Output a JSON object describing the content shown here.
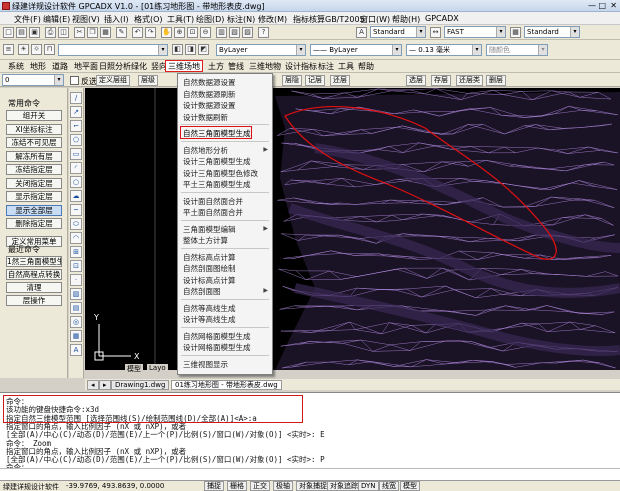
{
  "window": {
    "title": "绿建详规设计软件 GPCADX V1.0 - [01练习地形图 - 带地形表皮.dwg]",
    "minimize": "—",
    "maximize": "□",
    "close": "✕"
  },
  "menu": [
    "文件(F)",
    "编辑(E)",
    "视图(V)",
    "插入(I)",
    "格式(O)",
    "工具(T)",
    "绘图(D)",
    "标注(N)",
    "修改(M)",
    "指标核算GB/T2005",
    "窗口(W)",
    "帮助(H)",
    "GPCADX"
  ],
  "toolbar2": {
    "layer_combo": "ByLayer",
    "linetype_combo": "ByLayer",
    "lineweight_combo": "0.13 毫米",
    "color_combo": "随颜色",
    "text_style": "Standard",
    "dim_style": "FAST",
    "table_style": "Standard"
  },
  "toolbar3": {
    "layer_value": "0",
    "reverse_label": "反选",
    "define_layer_label": "定义层组"
  },
  "tabs": [
    "系统",
    "地形",
    "道路",
    "地平面",
    "日照分析",
    "绿化",
    "竖向",
    "三维场地",
    "土方",
    "管线",
    "三维地物",
    "设计指标",
    "标注",
    "工具",
    "帮助"
  ],
  "active_tab": "三维场地",
  "row4_buttons": [
    "层级",
    "层隐",
    "记层",
    "还层",
    "选层",
    "存层",
    "还层类",
    "删层"
  ],
  "left_panel": {
    "title": "常用命令",
    "buttons": [
      "组开关",
      "XI坐标标注",
      "冻结不可见层",
      "解冻所有层",
      "冻结指定层",
      "关闭指定层",
      "显示指定层",
      "显示全部层",
      "删除指定层",
      "定义常用菜单"
    ],
    "selected": "显示全部层",
    "recent_title": "最近命令",
    "recent": [
      "1然三角面模型生成",
      "自然高程点转换",
      "清理",
      "层操作"
    ]
  },
  "dropdown": {
    "items": [
      {
        "label": "自然数据源设置",
        "arrow": false
      },
      {
        "label": "自然数据源刷新",
        "arrow": false
      },
      {
        "label": "设计数据源设置",
        "arrow": false
      },
      {
        "label": "设计数据刷新",
        "arrow": false
      },
      {
        "label": "自然三角面模型生成",
        "arrow": false,
        "highlight": true
      },
      {
        "label": "自然地形分析",
        "arrow": true
      },
      {
        "label": "设计三角面模型生成",
        "arrow": false
      },
      {
        "label": "设计三角面模型色修改",
        "arrow": false
      },
      {
        "label": "平土三角面模型生成",
        "arrow": false
      },
      {
        "label": "设计面自然面合并",
        "arrow": false
      },
      {
        "label": "平土面自然面合并",
        "arrow": false
      },
      {
        "label": "三角面模型编辑",
        "arrow": true
      },
      {
        "label": "整体土方计算",
        "arrow": false
      },
      {
        "label": "自然标高点计算",
        "arrow": false
      },
      {
        "label": "自然剖面图绘制",
        "arrow": false
      },
      {
        "label": "设计标高点计算",
        "arrow": false
      },
      {
        "label": "自然剖面图",
        "arrow": true
      },
      {
        "label": "自然等高线生成",
        "arrow": false
      },
      {
        "label": "设计等高线生成",
        "arrow": false
      },
      {
        "label": "自然网格面模型生成",
        "arrow": false
      },
      {
        "label": "设计网格面模型生成",
        "arrow": false
      },
      {
        "label": "三维视图显示",
        "arrow": false
      }
    ]
  },
  "canvas_tabs": {
    "model": "模型",
    "layout": "Layo"
  },
  "doc_tabs": [
    "Drawing1.dwg",
    "01练习地形图 - 带地形表皮.dwg"
  ],
  "active_doc": "01练习地形图 - 带地形表皮.dwg",
  "ucs": {
    "y": "Y",
    "x": "X"
  },
  "command_lines": [
    "命令：",
    "  该功能的键盘快捷命令:x3d",
    "  指定自然三维模型范围 [选择范围线(S)/绘制范围线(D)/全部(A)]<A>:a",
    "指定窗口的角点，输入比例因子 (nX 或 nXP)，或者",
    "[全部(A)/中心(C)/动态(D)/范围(E)/上一个(P)/比例(S)/窗口(W)/对象(O)] <实时>: E",
    "命令： Zoom",
    "指定窗口的角点，输入比例因子 (nX 或 nXP)，或者",
    "[全部(A)/中心(C)/动态(D)/范围(E)/上一个(P)/比例(S)/窗口(W)/对象(O)] <实时>: P",
    "命令："
  ],
  "status": {
    "app": "绿建详规设计软件",
    "coords": "-39.9769, 493.8639, 0.0000",
    "toggles": [
      "捕捉",
      "栅格",
      "正交",
      "极轴",
      "对象捕捉",
      "对象追踪",
      "DYN",
      "线宽",
      "模型"
    ]
  },
  "colors": {
    "canvas_bg": "#000000",
    "mesh": "#b58ee6",
    "highlight": "#e01010"
  }
}
